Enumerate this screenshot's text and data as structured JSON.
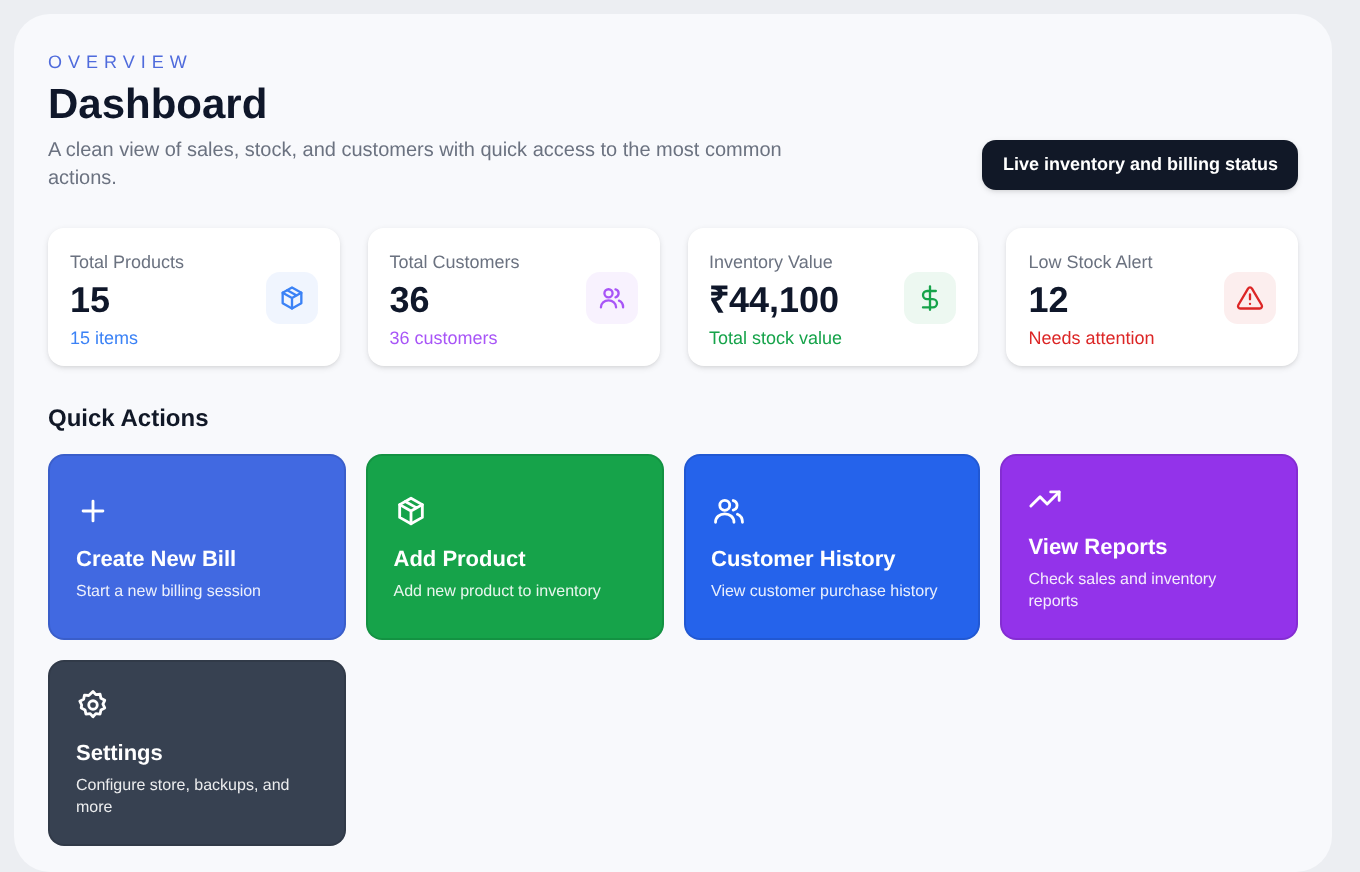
{
  "header": {
    "eyebrow": "OVERVIEW",
    "title": "Dashboard",
    "subtitle": "A clean view of sales, stock, and customers with quick access to the most common actions.",
    "status_badge": "Live inventory and billing status"
  },
  "stats": [
    {
      "label": "Total Products",
      "value": "15",
      "note": "15 items",
      "kind": "box",
      "color": "#3b82f6"
    },
    {
      "label": "Total Customers",
      "value": "36",
      "note": "36 customers",
      "kind": "users",
      "color": "#a855f7"
    },
    {
      "label": "Inventory Value",
      "value": "₹44,100",
      "note": "Total stock value",
      "kind": "dollar",
      "color": "#16a34a"
    },
    {
      "label": "Low Stock Alert",
      "value": "12",
      "note": "Needs attention",
      "kind": "warning",
      "color": "#dc2626"
    }
  ],
  "quick_actions": {
    "title": "Quick Actions",
    "items": [
      {
        "title": "Create New Bill",
        "description": "Start a new billing session",
        "kind": "plus",
        "color": "#4169e1"
      },
      {
        "title": "Add Product",
        "description": "Add new product to inventory",
        "kind": "box",
        "color": "#16a34a"
      },
      {
        "title": "Customer History",
        "description": "View customer purchase history",
        "kind": "users",
        "color": "#2563eb"
      },
      {
        "title": "View Reports",
        "description": "Check sales and inventory reports",
        "kind": "trend",
        "color": "#9333ea"
      },
      {
        "title": "Settings",
        "description": "Configure store, backups, and more",
        "kind": "gear",
        "color": "#374151"
      }
    ]
  }
}
